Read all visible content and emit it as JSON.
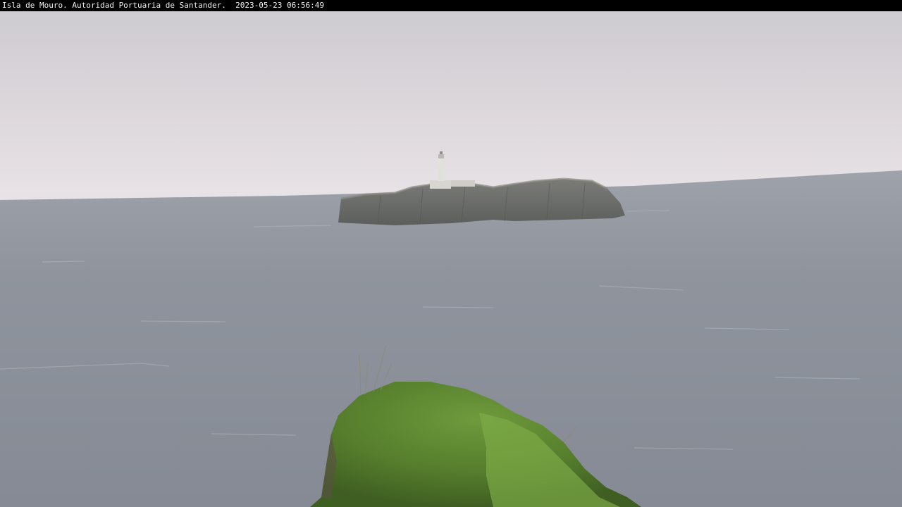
{
  "camera": {
    "caption": "Isla de Mouro. Autoridad Portuaria de Santander.",
    "timestamp": "2023-05-23 06:56:49"
  },
  "scene": {
    "description_icons": [
      "lighthouse-icon",
      "island-rock",
      "sea",
      "grassy-headland"
    ],
    "colors": {
      "sky_top": "#cfcdd2",
      "sky_horizon": "#e6e1e4",
      "sea": "#8b9099",
      "rock": "#6b6c68",
      "grass": "#5f8a33"
    }
  }
}
